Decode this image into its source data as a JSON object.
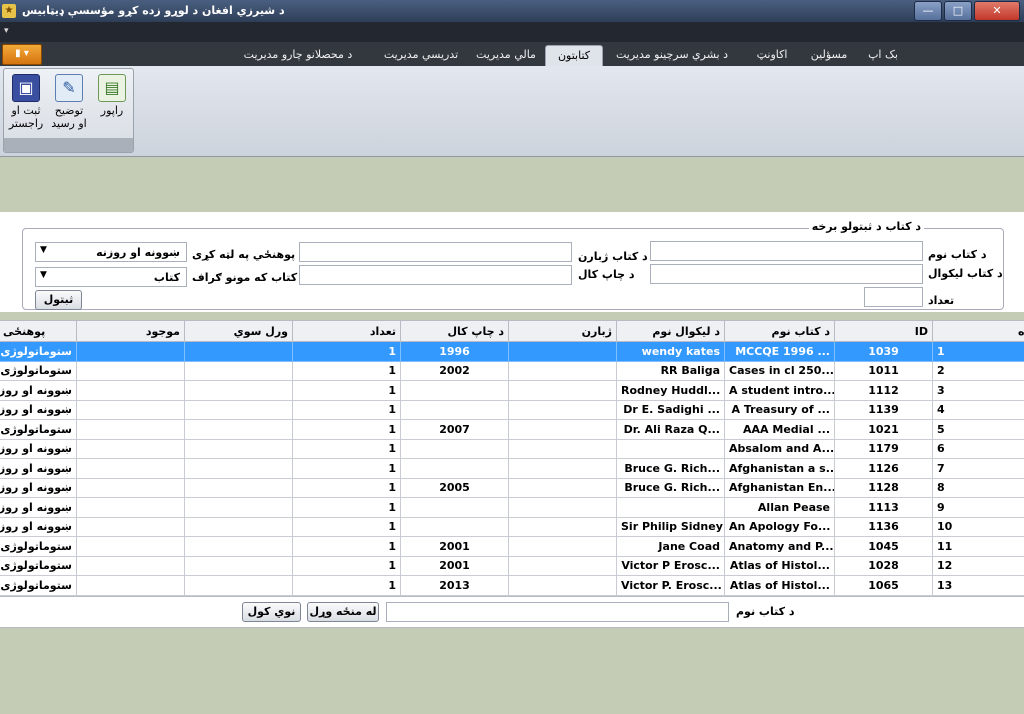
{
  "window": {
    "title": "د شيرزي افغان د لوړو زده کړو مؤسسې ډيټابيس",
    "minimize": "—",
    "maximize": "□",
    "close": "✕"
  },
  "qat_symbol": "▾",
  "app_button": "▾",
  "tabs": [
    {
      "label": "بک اپ",
      "active": false
    },
    {
      "label": "مسؤلين",
      "active": false
    },
    {
      "label": "اکاونټ",
      "active": false
    },
    {
      "label": "د بشري سرچينو مديريت",
      "active": false
    },
    {
      "label": "کتابتون",
      "active": true
    },
    {
      "label": "مالي مديريت",
      "active": false
    },
    {
      "label": "تدريسي مديريت",
      "active": false
    },
    {
      "label": "د محصلانو چارو مديريت",
      "active": false
    }
  ],
  "ribbon": {
    "buttons": [
      {
        "label_line1": "راپور",
        "label_line2": "",
        "icon": "report-icon"
      },
      {
        "label_line1": "توضيح",
        "label_line2": "او رسيد",
        "icon": "edit-icon"
      },
      {
        "label_line1": "ثبت او",
        "label_line2": "راجستر",
        "icon": "save-icon"
      }
    ]
  },
  "filter": {
    "legend": "د کتاب د ثبتولو برخه",
    "book_name_label": "د کتاب نوم",
    "author_label": "د کتاب ليکوال",
    "count_label": "تعداد",
    "language_label": "د کتاب ژبارن",
    "print_year_label": "د چاپ کال",
    "faculty_label": "پوهنځي په لټه کړی",
    "faculty_value": "ښوونه او روزنه",
    "monograph_label": "کتاب که مونو ګراف",
    "monograph_value": "کتاب",
    "save_button": "ثبتول"
  },
  "table": {
    "headers": {
      "row_no": "شميره",
      "id": "ID",
      "book_name": "د کتاب نوم",
      "author": "د ليکوال نوم",
      "translator": "ژبارن",
      "print_year": "د چاپ کال",
      "count": "تعداد",
      "loaned": "ورل سوي",
      "available": "موجود",
      "faculty": "پوهنځی"
    },
    "rows": [
      {
        "no": "1",
        "id": "1039",
        "book": "MCCQE 1996 ...",
        "author": "wendy kates",
        "year": "1996",
        "count": "1",
        "faculty": "ستوماتولوژی"
      },
      {
        "no": "2",
        "id": "1011",
        "book": "Cases in cl 250...",
        "author": "RR Baliga",
        "year": "2002",
        "count": "1",
        "faculty": "ستوماتولوژی"
      },
      {
        "no": "3",
        "id": "1112",
        "book": "A student intro...",
        "author": "Rodney Huddl...",
        "year": "",
        "count": "1",
        "faculty": "ښوونه او روزنه"
      },
      {
        "no": "4",
        "id": "1139",
        "book": "A Treasury of ...",
        "author": "Dr E. Sadighi ...",
        "year": "",
        "count": "1",
        "faculty": "ښوونه او روزنه"
      },
      {
        "no": "5",
        "id": "1021",
        "book": "AAA Medial ...",
        "author": "Dr. Ali Raza Q...",
        "year": "2007",
        "count": "1",
        "faculty": "ستوماتولوژی"
      },
      {
        "no": "6",
        "id": "1179",
        "book": "Absalom and A...",
        "author": "",
        "year": "",
        "count": "1",
        "faculty": "ښوونه او روزنه"
      },
      {
        "no": "7",
        "id": "1126",
        "book": "Afghanistan a s...",
        "author": "Bruce G. Rich...",
        "year": "",
        "count": "1",
        "faculty": "ښوونه او روزنه"
      },
      {
        "no": "8",
        "id": "1128",
        "book": "Afghanistan En...",
        "author": "Bruce G. Rich...",
        "year": "2005",
        "count": "1",
        "faculty": "ښوونه او روزنه"
      },
      {
        "no": "9",
        "id": "1113",
        "book": "Allan Pease",
        "author": "",
        "year": "",
        "count": "1",
        "faculty": "ښوونه او روزنه"
      },
      {
        "no": "10",
        "id": "1136",
        "book": "An Apology Fo...",
        "author": "Sir Philip Sidney",
        "year": "",
        "count": "1",
        "faculty": "ښوونه او روزنه"
      },
      {
        "no": "11",
        "id": "1045",
        "book": "Anatomy and P...",
        "author": "Jane Coad",
        "year": "2001",
        "count": "1",
        "faculty": "ستوماتولوژی"
      },
      {
        "no": "12",
        "id": "1028",
        "book": "Atlas of Histol...",
        "author": "Victor P Erosc...",
        "year": "2001",
        "count": "1",
        "faculty": "ستوماتولوژی"
      },
      {
        "no": "13",
        "id": "1065",
        "book": "Atlas of Histol...",
        "author": "Victor P. Erosc...",
        "year": "2013",
        "count": "1",
        "faculty": "ستوماتولوژی"
      }
    ]
  },
  "bottom": {
    "book_name_label": "د کتاب نوم",
    "remove_button": "له منځه وړل",
    "new_button": "نوي کول"
  }
}
